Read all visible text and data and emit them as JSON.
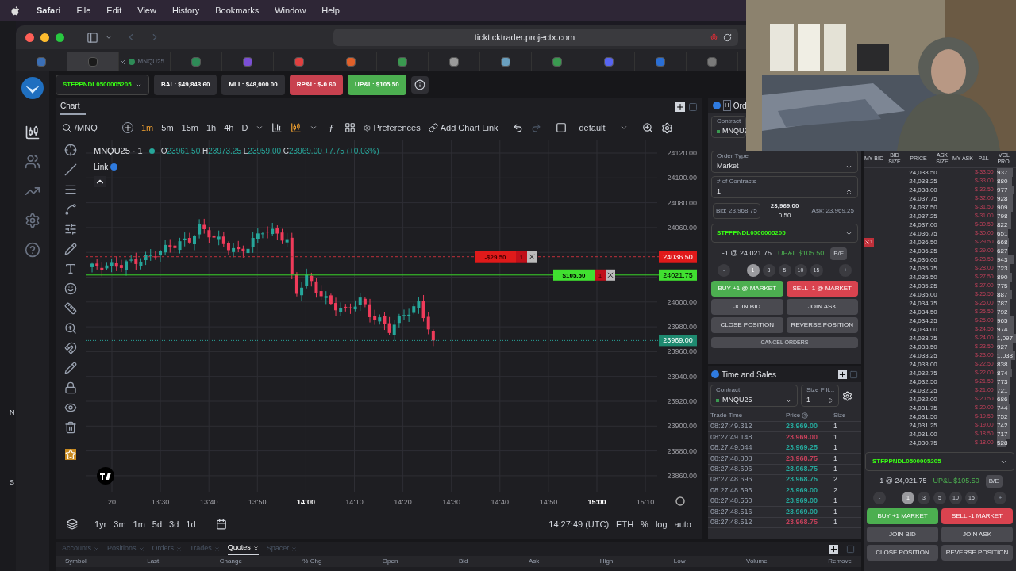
{
  "menu_bar": {
    "app": "Safari",
    "items": [
      "File",
      "Edit",
      "View",
      "History",
      "Bookmarks",
      "Window",
      "Help"
    ]
  },
  "desktop_strip": [
    "N",
    "S"
  ],
  "browser": {
    "url": "tickticktrader.projectx.com",
    "tabs": [
      {
        "selected": false
      },
      {
        "selected": true
      },
      {
        "selected": false,
        "label": "MNQU25..."
      },
      {
        "selected": false
      },
      {
        "selected": false
      },
      {
        "selected": false
      },
      {
        "selected": false
      },
      {
        "selected": false
      },
      {
        "selected": false
      },
      {
        "selected": false
      },
      {
        "selected": false
      },
      {
        "selected": false
      },
      {
        "selected": false
      },
      {
        "selected": false
      }
    ]
  },
  "account_bar": {
    "account": "STFPPNDL0500005205",
    "stats": [
      {
        "text": "BAL: $49,843.60",
        "color": "#2f2f34"
      },
      {
        "text": "MLL: $48,000.00",
        "color": "#2f2f34"
      },
      {
        "text": "RP&L: $-0.60",
        "color": "#c8414f"
      },
      {
        "text": "UP&L: $105.50",
        "color": "#4caf50"
      }
    ]
  },
  "chart": {
    "tab": "Chart",
    "symbol": "/MNQ",
    "intervals": [
      {
        "label": "1m",
        "selected": true
      },
      {
        "label": "5m",
        "selected": false
      },
      {
        "label": "15m",
        "selected": false
      },
      {
        "label": "1h",
        "selected": false
      },
      {
        "label": "4h",
        "selected": false
      },
      {
        "label": "D",
        "selected": false
      }
    ],
    "indicators": "ƒ",
    "preferences": "Preferences",
    "add_link": "Add Chart Link",
    "layout": "default",
    "legend": {
      "title": "MNQU25 · 1",
      "ohlc": [
        {
          "k": "O",
          "v": "23961.50"
        },
        {
          "k": "H",
          "v": "23973.25"
        },
        {
          "k": "L",
          "v": "23959.00"
        },
        {
          "k": "C",
          "v": "23969.00"
        }
      ],
      "change": "+7.75 (+0.03%)",
      "link": "Link"
    },
    "price_ticks": [
      "24120.00",
      "24100.00",
      "24080.00",
      "24060.00",
      "24000.00",
      "23980.00",
      "23960.00",
      "23940.00",
      "23920.00",
      "23900.00",
      "23880.00",
      "23860.00"
    ],
    "time_ticks": [
      {
        "label": "20",
        "bold": false
      },
      {
        "label": "13:30",
        "bold": false
      },
      {
        "label": "13:40",
        "bold": false
      },
      {
        "label": "13:50",
        "bold": false
      },
      {
        "label": "14:00",
        "bold": true
      },
      {
        "label": "14:10",
        "bold": false
      },
      {
        "label": "14:20",
        "bold": false
      },
      {
        "label": "14:30",
        "bold": false
      },
      {
        "label": "14:40",
        "bold": false
      },
      {
        "label": "14:50",
        "bold": false
      },
      {
        "label": "15:00",
        "bold": true
      },
      {
        "label": "15:10",
        "bold": false
      }
    ],
    "order_lines": [
      {
        "kind": "stop",
        "pnl": "-$29.50",
        "qty": "1",
        "price": "24036.50"
      },
      {
        "kind": "position",
        "pnl": "$105.50",
        "qty": "1",
        "price": "24021.75"
      }
    ],
    "last_price": "23969.00",
    "ranges": [
      "1yr",
      "3m",
      "1m",
      "5d",
      "3d",
      "1d"
    ],
    "clock": "14:27:49 (UTC)",
    "session": "ETH",
    "scale_options": [
      "%",
      "log",
      "auto"
    ]
  },
  "order_panel": {
    "hotkey": "H",
    "tab": "Ord",
    "contract_label": "Contract",
    "contract": "MNQU2",
    "order_type_label": "Order Type",
    "order_type": "Market",
    "contracts_label": "# of Contracts",
    "contracts": "1",
    "bid": "Bid: 23,968.75",
    "last": "23,969.00",
    "spread": "0.50",
    "ask": "Ask: 23,969.25",
    "account": "STFPPNDL0500005205",
    "position": "-1 @ 24,021.75",
    "upl": "UP&L $105.50",
    "be": "B/E",
    "minus": "-",
    "plus": "+",
    "sizes": [
      {
        "label": "1",
        "selected": true
      },
      {
        "label": "3",
        "selected": false
      },
      {
        "label": "5",
        "selected": false
      },
      {
        "label": "10",
        "selected": false
      },
      {
        "label": "15",
        "selected": false
      }
    ],
    "buy": "BUY +1 @ MARKET",
    "sell": "SELL -1 @ MARKET",
    "join_bid": "JOIN BID",
    "join_ask": "JOIN ASK",
    "close": "CLOSE POSITION",
    "reverse": "REVERSE POSITION",
    "cancel": "CANCEL ORDERS"
  },
  "time_and_sales": {
    "tab": "Time and Sales",
    "contract_label": "Contract",
    "contract": "MNQU25",
    "size_label": "Size Filt...",
    "size": "1",
    "columns": [
      "Trade Time",
      "Price",
      "Size"
    ],
    "rows": [
      {
        "time": "08:27:49.312",
        "price": "23,969.00",
        "size": "1",
        "color": "#26a69a"
      },
      {
        "time": "08:27:49.148",
        "price": "23,969.00",
        "size": "1",
        "color": "#c2405a"
      },
      {
        "time": "08:27:49.044",
        "price": "23,969.25",
        "size": "1",
        "color": "#26a69a"
      },
      {
        "time": "08:27:48.808",
        "price": "23,968.75",
        "size": "1",
        "color": "#c2405a"
      },
      {
        "time": "08:27:48.696",
        "price": "23,968.75",
        "size": "1",
        "color": "#26a69a"
      },
      {
        "time": "08:27:48.696",
        "price": "23,968.75",
        "size": "2",
        "color": "#26a69a"
      },
      {
        "time": "08:27:48.696",
        "price": "23,969.00",
        "size": "2",
        "color": "#26a69a"
      },
      {
        "time": "08:27:48.560",
        "price": "23,969.00",
        "size": "1",
        "color": "#26a69a"
      },
      {
        "time": "08:27:48.516",
        "price": "23,969.00",
        "size": "1",
        "color": "#26a69a"
      },
      {
        "time": "08:27:48.512",
        "price": "23,968.75",
        "size": "1",
        "color": "#c2405a"
      }
    ]
  },
  "dom": {
    "columns": [
      "MY BID",
      "BID SIZE",
      "PRICE",
      "ASK SIZE",
      "MY ASK",
      "P&L",
      "VOL PRO."
    ],
    "rows": [
      {
        "price": "24,038.50",
        "pnl": "$-33.50",
        "vol": "937"
      },
      {
        "price": "24,038.25",
        "pnl": "$-33.00",
        "vol": "880"
      },
      {
        "price": "24,038.00",
        "pnl": "$-32.50",
        "vol": "977"
      },
      {
        "price": "24,037.75",
        "pnl": "$-32.00",
        "vol": "928"
      },
      {
        "price": "24,037.50",
        "pnl": "$-31.50",
        "vol": "909"
      },
      {
        "price": "24,037.25",
        "pnl": "$-31.00",
        "vol": "798"
      },
      {
        "price": "24,037.00",
        "pnl": "$-30.50",
        "vol": "822"
      },
      {
        "price": "24,036.75",
        "pnl": "$-30.00",
        "vol": "651"
      },
      {
        "price": "24,036.50",
        "pnl": "$-29.50",
        "vol": "668",
        "marker": "1"
      },
      {
        "price": "24,036.25",
        "pnl": "$-29.00",
        "vol": "627"
      },
      {
        "price": "24,036.00",
        "pnl": "$-28.50",
        "vol": "943"
      },
      {
        "price": "24,035.75",
        "pnl": "$-28.00",
        "vol": "723"
      },
      {
        "price": "24,035.50",
        "pnl": "$-27.50",
        "vol": "890"
      },
      {
        "price": "24,035.25",
        "pnl": "$-27.00",
        "vol": "775"
      },
      {
        "price": "24,035.00",
        "pnl": "$-26.50",
        "vol": "887"
      },
      {
        "price": "24,034.75",
        "pnl": "$-26.00",
        "vol": "787"
      },
      {
        "price": "24,034.50",
        "pnl": "$-25.50",
        "vol": "792"
      },
      {
        "price": "24,034.25",
        "pnl": "$-25.00",
        "vol": "965"
      },
      {
        "price": "24,034.00",
        "pnl": "$-24.50",
        "vol": "974"
      },
      {
        "price": "24,033.75",
        "pnl": "$-24.00",
        "vol": "1,097"
      },
      {
        "price": "24,033.50",
        "pnl": "$-23.50",
        "vol": "927"
      },
      {
        "price": "24,033.25",
        "pnl": "$-23.00",
        "vol": "1,038"
      },
      {
        "price": "24,033.00",
        "pnl": "$-22.50",
        "vol": "838"
      },
      {
        "price": "24,032.75",
        "pnl": "$-22.00",
        "vol": "874"
      },
      {
        "price": "24,032.50",
        "pnl": "$-21.50",
        "vol": "773"
      },
      {
        "price": "24,032.25",
        "pnl": "$-21.00",
        "vol": "721"
      },
      {
        "price": "24,032.00",
        "pnl": "$-20.50",
        "vol": "686"
      },
      {
        "price": "24,031.75",
        "pnl": "$-20.00",
        "vol": "744"
      },
      {
        "price": "24,031.50",
        "pnl": "$-19.50",
        "vol": "752"
      },
      {
        "price": "24,031.25",
        "pnl": "$-19.00",
        "vol": "742"
      },
      {
        "price": "24,031.00",
        "pnl": "$-18.50",
        "vol": "717"
      },
      {
        "price": "24,030.75",
        "pnl": "$-18.00",
        "vol": "528"
      }
    ],
    "account": "STFPPNDL0500005205",
    "position": "-1 @ 24,021.75",
    "upl": "UP&L $105.50",
    "be": "B/E",
    "minus": "-",
    "plus": "+",
    "sizes": [
      {
        "label": "1",
        "selected": true
      },
      {
        "label": "3",
        "selected": false
      },
      {
        "label": "5",
        "selected": false
      },
      {
        "label": "10",
        "selected": false
      },
      {
        "label": "15",
        "selected": false
      }
    ],
    "buy": "BUY +1 MARKET",
    "sell": "SELL -1 MARKET",
    "join_bid": "JOIN BID",
    "join_ask": "JOIN ASK",
    "close": "CLOSE POSITION",
    "reverse": "REVERSE POSITION"
  },
  "bottom_panel": {
    "tabs": [
      {
        "label": "Accounts",
        "selected": false
      },
      {
        "label": "Positions",
        "selected": false
      },
      {
        "label": "Orders",
        "selected": false
      },
      {
        "label": "Trades",
        "selected": false
      },
      {
        "label": "Quotes",
        "selected": true
      },
      {
        "label": "Spacer",
        "selected": false
      }
    ],
    "columns": [
      "Symbol",
      "Last",
      "Change",
      "% Chg",
      "Open",
      "Bid",
      "Ask",
      "High",
      "Low",
      "Volume",
      "Remove"
    ]
  },
  "webcam": {
    "kind": "picture"
  }
}
